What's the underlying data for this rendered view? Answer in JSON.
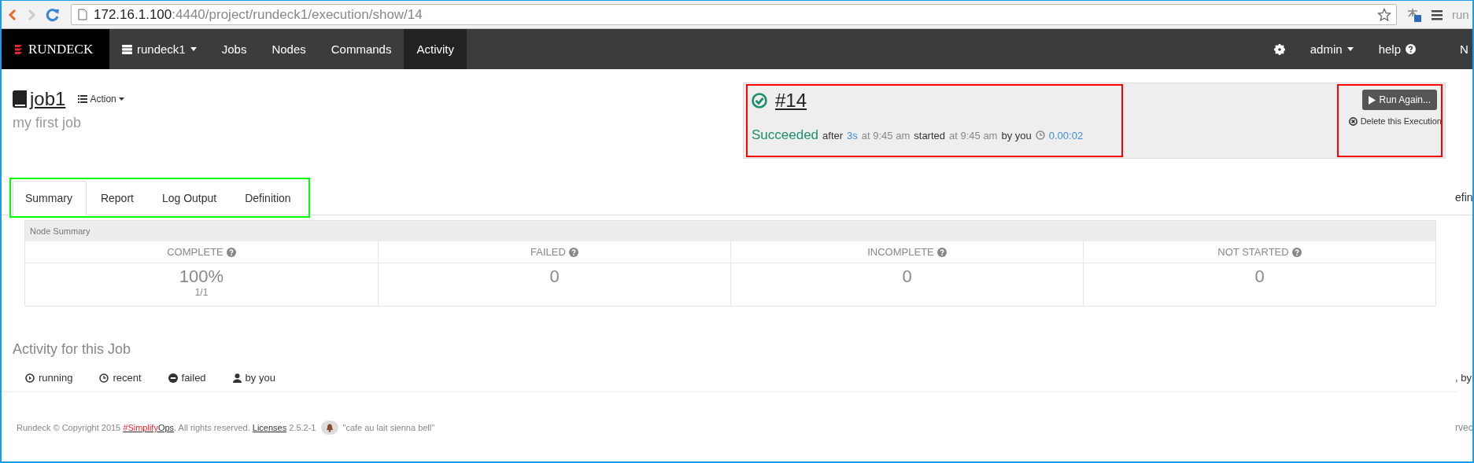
{
  "browser": {
    "url_host": "172.16.1.100",
    "url_path": ":4440/project/rundeck1/execution/show/14",
    "edge_fragment": "run"
  },
  "navbar": {
    "logo": "RUNDECK",
    "items": [
      {
        "label": "rundeck1",
        "kind": "project",
        "selected": false
      },
      {
        "label": "Jobs",
        "kind": "link",
        "selected": false
      },
      {
        "label": "Nodes",
        "kind": "link",
        "selected": false
      },
      {
        "label": "Commands",
        "kind": "link",
        "selected": false
      },
      {
        "label": "Activity",
        "kind": "link",
        "selected": true
      }
    ],
    "user": "admin",
    "help": "help",
    "edge_fragment": "N"
  },
  "job": {
    "name": "job1",
    "action": "Action",
    "description": "my first job"
  },
  "execution": {
    "number": "#14",
    "color": "#ff0000",
    "status_line": [
      {
        "text": "Succeeded",
        "kind": "status"
      },
      {
        "text": "after",
        "kind": "label"
      },
      {
        "text": "3s",
        "kind": "link"
      },
      {
        "text": "at 9:45 am",
        "kind": "muted"
      },
      {
        "text": "started",
        "kind": "label"
      },
      {
        "text": "at 9:45 am",
        "kind": "muted"
      },
      {
        "text": "by you",
        "kind": "label"
      },
      {
        "text": "0.00:02",
        "kind": "duration"
      }
    ],
    "actions": {
      "color": "#ff0000",
      "run_again": "Run Again...",
      "delete": "Delete this Execution"
    }
  },
  "tabs": {
    "color": "#00ff00",
    "edge_fragment": "efin",
    "items": [
      {
        "label": "Summary",
        "selected": true
      },
      {
        "label": "Report",
        "selected": false
      },
      {
        "label": "Log Output",
        "selected": false
      },
      {
        "label": "Definition",
        "selected": false
      }
    ]
  },
  "node_summary": {
    "title": "Node Summary",
    "columns": [
      {
        "label": "COMPLETE",
        "value": "100%",
        "detail": "1/1"
      },
      {
        "label": "FAILED",
        "value": "0"
      },
      {
        "label": "INCOMPLETE",
        "value": "0"
      },
      {
        "label": "NOT STARTED",
        "value": "0"
      }
    ]
  },
  "activity": {
    "title": "Activity for this Job",
    "edge_fragment": ", by",
    "filters": [
      {
        "label": "running",
        "kind": "running"
      },
      {
        "label": "recent",
        "kind": "recent"
      },
      {
        "label": "failed",
        "kind": "failed"
      },
      {
        "label": "by you",
        "kind": "user"
      }
    ]
  },
  "footer": {
    "copyright": "Rundeck © Copyright 2015",
    "brand_link": [
      "#Simplify",
      "Ops"
    ],
    "rights": ". All rights reserved.",
    "licenses": "Licenses",
    "version": "2.5.2-1",
    "codename": "\"cafe au lait sienna bell\"",
    "edge_fragment": "rvec"
  }
}
